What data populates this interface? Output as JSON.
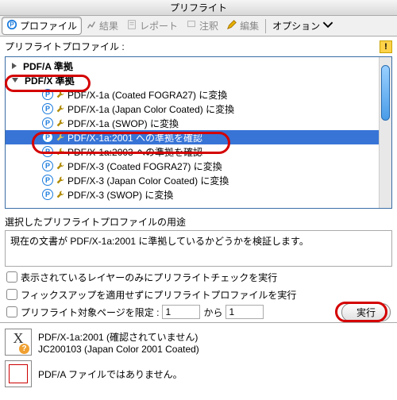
{
  "window": {
    "title": "プリフライト"
  },
  "toolbar": {
    "profile": "プロファイル",
    "results": "結果",
    "report": "レポート",
    "annotation": "注釈",
    "edit": "編集",
    "options": "オプション"
  },
  "section": {
    "preflight_profile_label": "プリフライトプロファイル :"
  },
  "tree": {
    "group_pdfa": "PDF/A 準拠",
    "group_pdfx": "PDF/X 準拠",
    "items": [
      "PDF/X-1a (Coated FOGRA27) に変換",
      "PDF/X-1a (Japan Color Coated) に変換",
      "PDF/X-1a (SWOP) に変換",
      "PDF/X-1a:2001 への準拠を確認",
      "PDF/X-1a:2003 への準拠を確認",
      "PDF/X-3 (Coated FOGRA27) に変換",
      "PDF/X-3 (Japan Color Coated) に変換",
      "PDF/X-3 (SWOP) に変換"
    ]
  },
  "purpose": {
    "heading": "選択したプリフライトプロファイルの用途",
    "text": "現在の文書が PDF/X-1a:2001 に準拠しているかどうかを検証します。"
  },
  "options": {
    "visible_layers": "表示されているレイヤーのみにプリフライトチェックを実行",
    "no_fixups": "フィックスアップを適用せずにプリフライトプロファイルを実行",
    "limit_pages": "プリフライト対象ページを限定 :",
    "from_value": "1",
    "to_label": "から",
    "to_value": "1",
    "run": "実行"
  },
  "footer": {
    "pdfx_line1": "PDF/X-1a:2001 (確認されていません)",
    "pdfx_line2": "JC200103 (Japan Color 2001 Coated)",
    "pdfa_line": "PDF/A ファイルではありません。"
  }
}
